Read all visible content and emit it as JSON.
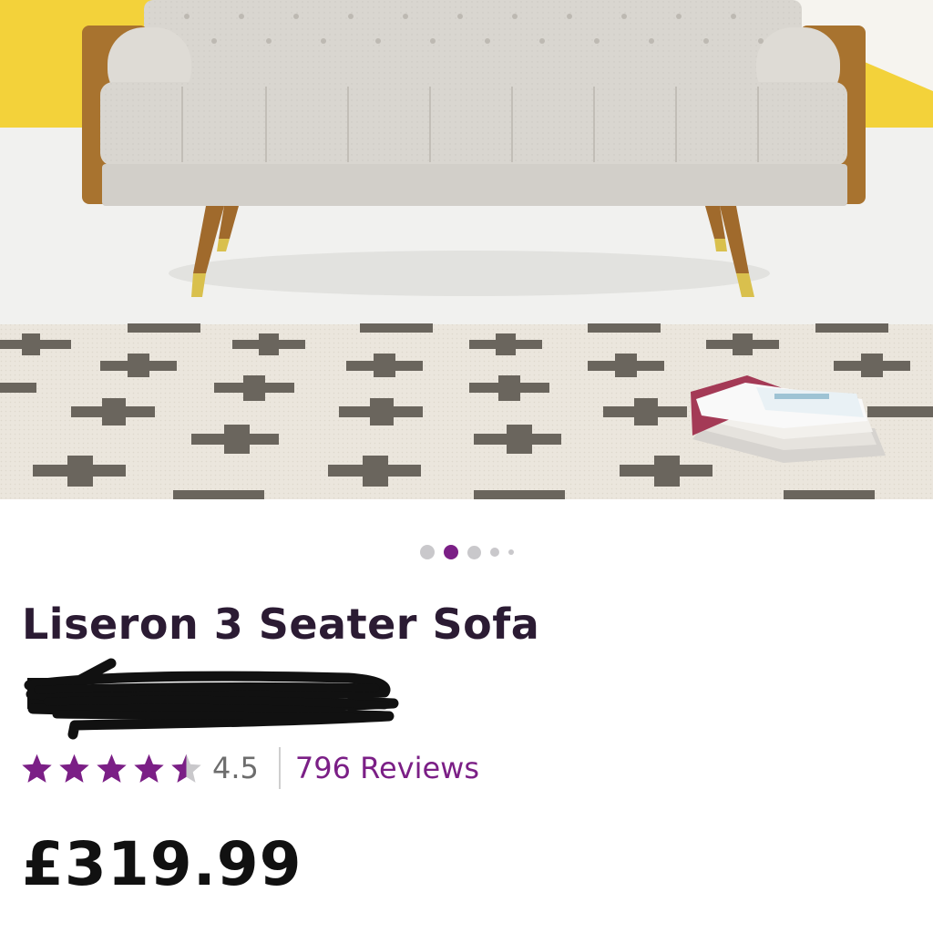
{
  "colors": {
    "accent": "#7b1f86",
    "title_text": "#2b1b33",
    "price_text": "#111111",
    "wall_accent": "#f3d23a"
  },
  "product": {
    "image_alt_icon": "sofa-photo",
    "title": "Liseron 3 Seater Sofa",
    "redacted_line": "redacted",
    "rating": {
      "value": 4.5,
      "display": "4.5",
      "max_stars": 5
    },
    "reviews_label": "796 Reviews",
    "price": "£319.99"
  },
  "carousel": {
    "count": 5,
    "active_index": 1
  }
}
